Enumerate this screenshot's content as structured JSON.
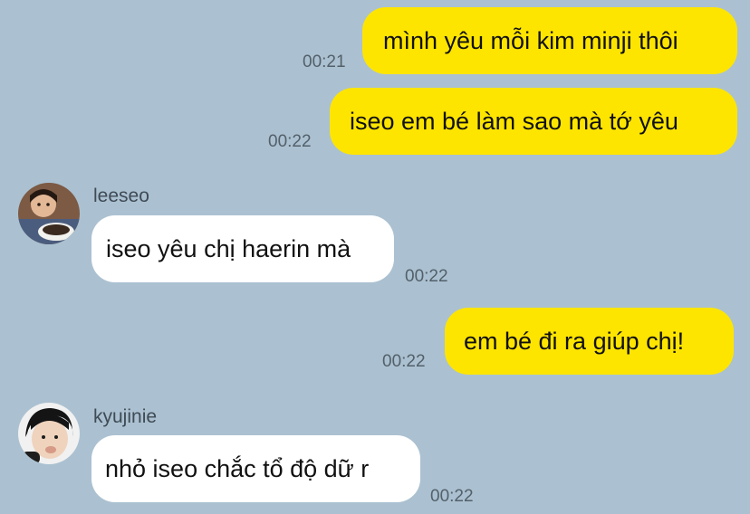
{
  "messages": [
    {
      "id": "m1",
      "side": "me",
      "text": "mình yêu mỗi kim minji thôi",
      "time": "00:21"
    },
    {
      "id": "m2",
      "side": "me",
      "text": "iseo em bé làm sao mà tớ yêu",
      "time": "00:22"
    },
    {
      "id": "m3",
      "side": "other",
      "sender": "leeseo",
      "text": "iseo yêu chị haerin mà",
      "time": "00:22",
      "avatar": "leeseo-avatar"
    },
    {
      "id": "m4",
      "side": "me",
      "text": "em bé đi ra giúp chị!",
      "time": "00:22"
    },
    {
      "id": "m5",
      "side": "other",
      "sender": "kyujinie",
      "text": "nhỏ iseo chắc tổ độ dữ r",
      "time": "00:22",
      "avatar": "kyujinie-avatar"
    }
  ],
  "colors": {
    "background": "#abc1d1",
    "my_bubble": "#fee500",
    "other_bubble": "#ffffff"
  }
}
